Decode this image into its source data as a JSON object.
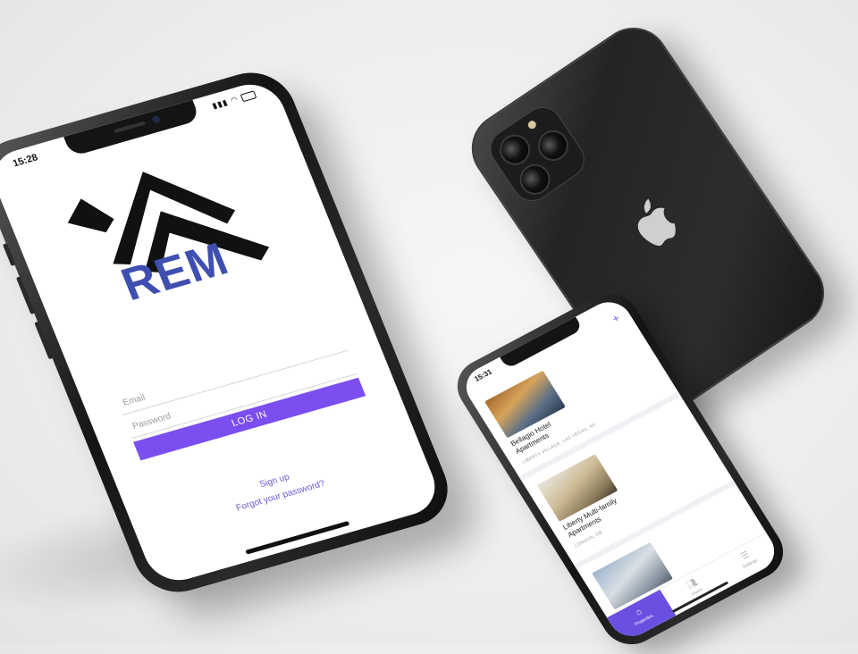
{
  "login_phone": {
    "status_time": "15:28",
    "logo_text": "REM",
    "email_placeholder": "Email",
    "password_placeholder": "Password",
    "login_button": "LOG IN",
    "signup_link": "Sign up",
    "forgot_link": "Forgot your password?",
    "accent_color": "#7b4ef0",
    "logo_color": "#3f4fb0"
  },
  "list_phone": {
    "status_time": "15:31",
    "add_icon": "plus-icon",
    "listings": [
      {
        "title": "Bellagio Hotel Apartments",
        "location": "LIBERTY VILLAGE, LAS VEGAS, NV"
      },
      {
        "title": "Liberty Multi-family Apartments",
        "location": "LONDON, GB"
      },
      {
        "title": "",
        "location": ""
      }
    ],
    "tabs": [
      {
        "label": "Properties",
        "icon": "house-icon",
        "active": true
      },
      {
        "label": "Users",
        "icon": "users-icon",
        "active": false
      },
      {
        "label": "Settings",
        "icon": "menu-icon",
        "active": false
      }
    ],
    "accent_color": "#6a4fe0"
  },
  "back_phone": {
    "logo_icon": "apple-logo-icon"
  }
}
